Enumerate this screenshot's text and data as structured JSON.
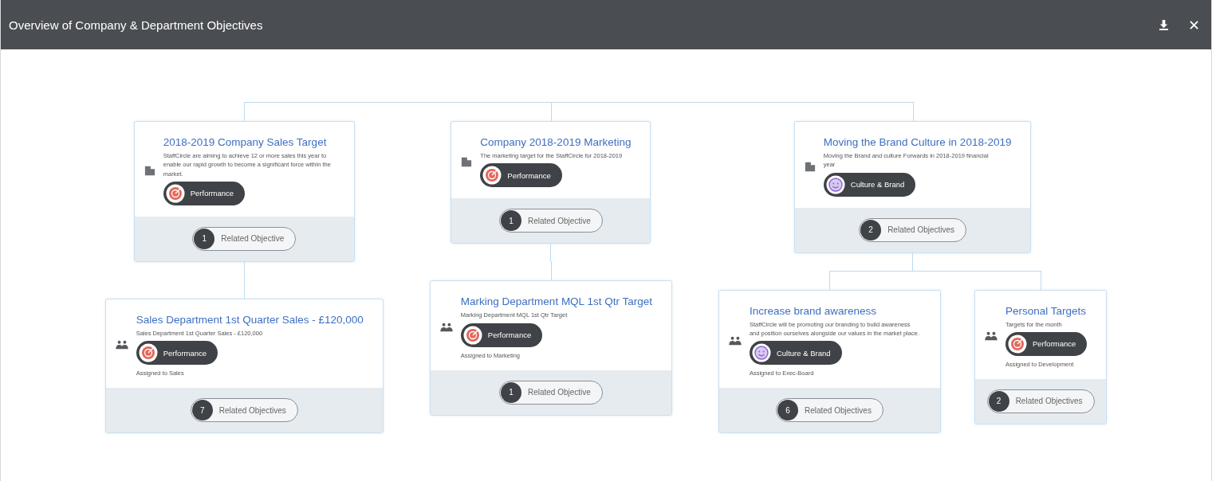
{
  "window": {
    "title": "Overview of Company & Department Objectives"
  },
  "objectives": [
    {
      "kind": "company",
      "title": "2018-2019 Company Sales Target",
      "description": "StaffCircle are aiming to achieve 12 or more sales this year to enable our rapid growth to become a significant force within the market.",
      "category": {
        "kind": "performance",
        "label": "Performance"
      },
      "related": {
        "count": "1",
        "label": "Related Objective"
      },
      "children": [
        {
          "kind": "team",
          "title": "Sales Department 1st Quarter Sales - £120,000",
          "description": "Sales Department 1st Quarter Sales - £120,000",
          "category": {
            "kind": "performance",
            "label": "Performance"
          },
          "assigned": "Assigned to Sales",
          "related": {
            "count": "7",
            "label": "Related Objectives"
          }
        }
      ]
    },
    {
      "kind": "company",
      "title": "Company 2018-2019 Marketing",
      "description": "The marketing target for the StaffCircle for 2018-2019",
      "category": {
        "kind": "performance",
        "label": "Performance"
      },
      "related": {
        "count": "1",
        "label": "Related Objective"
      },
      "children": [
        {
          "kind": "team",
          "title": "Marking Department MQL 1st Qtr Target",
          "description": "Marking Department MQL 1st Qtr Target",
          "category": {
            "kind": "performance",
            "label": "Performance"
          },
          "assigned": "Assigned to Marketing",
          "related": {
            "count": "1",
            "label": "Related Objective"
          }
        }
      ]
    },
    {
      "kind": "company",
      "title": "Moving the Brand Culture in 2018-2019",
      "description": "Moving the Brand and culture Forwards in 2018-2019 financial year",
      "category": {
        "kind": "culture",
        "label": "Culture & Brand"
      },
      "related": {
        "count": "2",
        "label": "Related Objectives"
      },
      "children": [
        {
          "kind": "team",
          "title": "Increase brand awareness",
          "description": "StaffCircle will be promoting our branding to build awareness and position ourselves alongside our values in the market place.",
          "category": {
            "kind": "culture",
            "label": "Culture & Brand"
          },
          "assigned": "Assigned to Exec-Board",
          "related": {
            "count": "6",
            "label": "Related Objectives"
          }
        },
        {
          "kind": "team",
          "title": "Personal Targets",
          "description": "Targets for the month",
          "category": {
            "kind": "performance",
            "label": "Performance"
          },
          "assigned": "Assigned to Development",
          "related": {
            "count": "2",
            "label": "Related Objectives"
          }
        }
      ]
    }
  ]
}
